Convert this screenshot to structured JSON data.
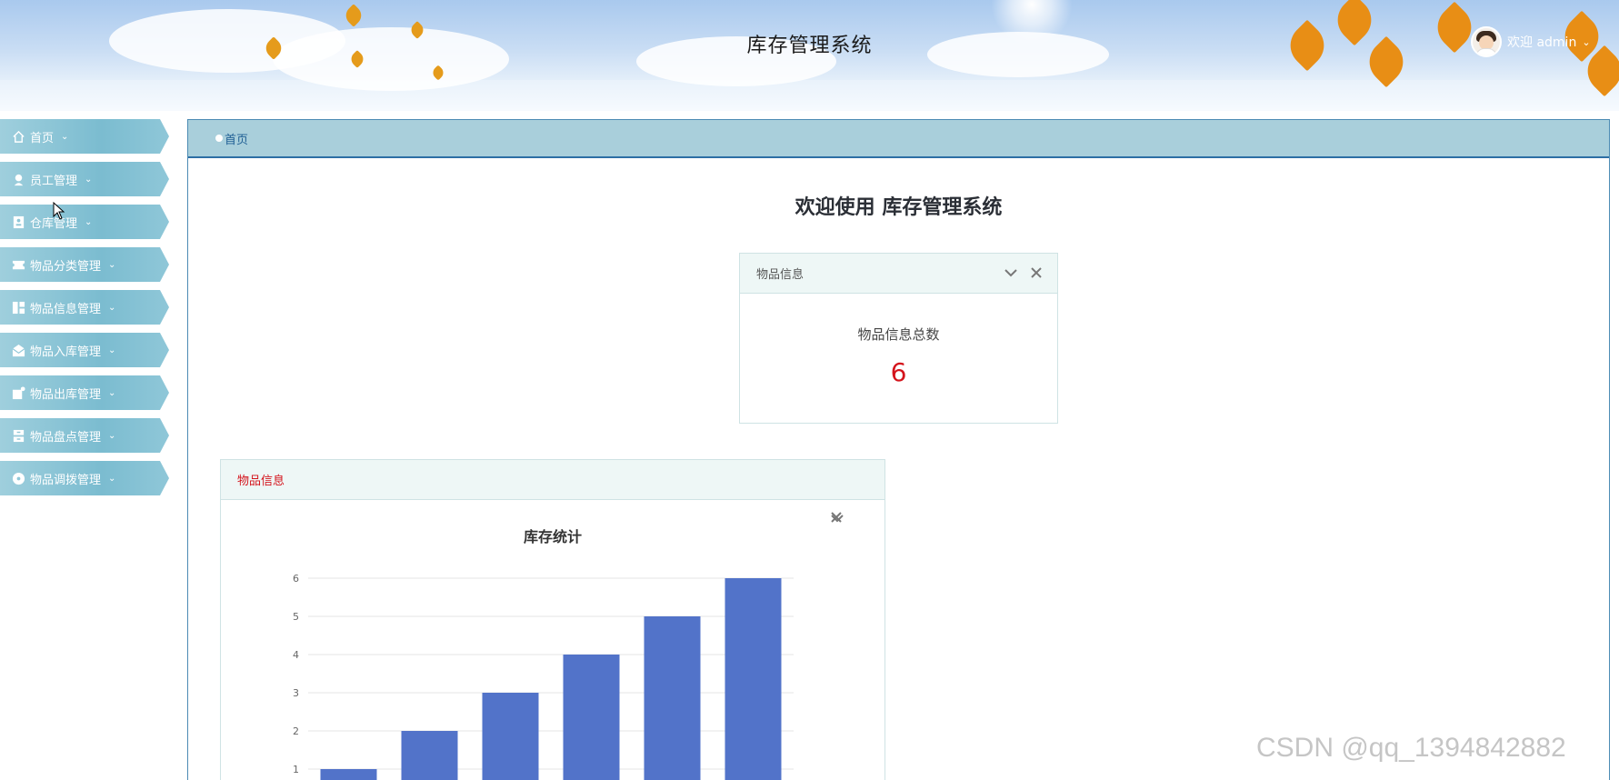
{
  "header": {
    "title": "库存管理系统",
    "welcome": "欢迎 admin"
  },
  "sidebar": {
    "items": [
      {
        "label": "首页",
        "icon": "home-icon"
      },
      {
        "label": "员工管理",
        "icon": "user-icon"
      },
      {
        "label": "仓库管理",
        "icon": "warehouse-icon"
      },
      {
        "label": "物品分类管理",
        "icon": "ticket-icon"
      },
      {
        "label": "物品信息管理",
        "icon": "grid-icon"
      },
      {
        "label": "物品入库管理",
        "icon": "mail-icon"
      },
      {
        "label": "物品出库管理",
        "icon": "folder-icon"
      },
      {
        "label": "物品盘点管理",
        "icon": "cabinet-icon"
      },
      {
        "label": "物品调拨管理",
        "icon": "disc-icon"
      }
    ]
  },
  "breadcrumb": {
    "current": "首页"
  },
  "main": {
    "welcome_title": "欢迎使用 库存管理系统",
    "count_card": {
      "title": "物品信息",
      "label": "物品信息总数",
      "value": "6"
    },
    "chart_card": {
      "title": "物品信息"
    }
  },
  "chart_data": {
    "type": "bar",
    "title": "库存统计",
    "categories": [
      "",
      "",
      "",
      "",
      "",
      ""
    ],
    "values": [
      1,
      2,
      3,
      4,
      5,
      6
    ],
    "y_ticks": [
      "1",
      "2",
      "3",
      "4",
      "5",
      "6"
    ],
    "ylim": [
      0,
      6
    ],
    "grid": true,
    "bar_color": "#5273c9"
  },
  "watermark": "CSDN @qq_1394842882",
  "colors": {
    "accent": "#2d6fa5",
    "count_value": "#d4141c",
    "sidebar": "#7bbcd0"
  }
}
